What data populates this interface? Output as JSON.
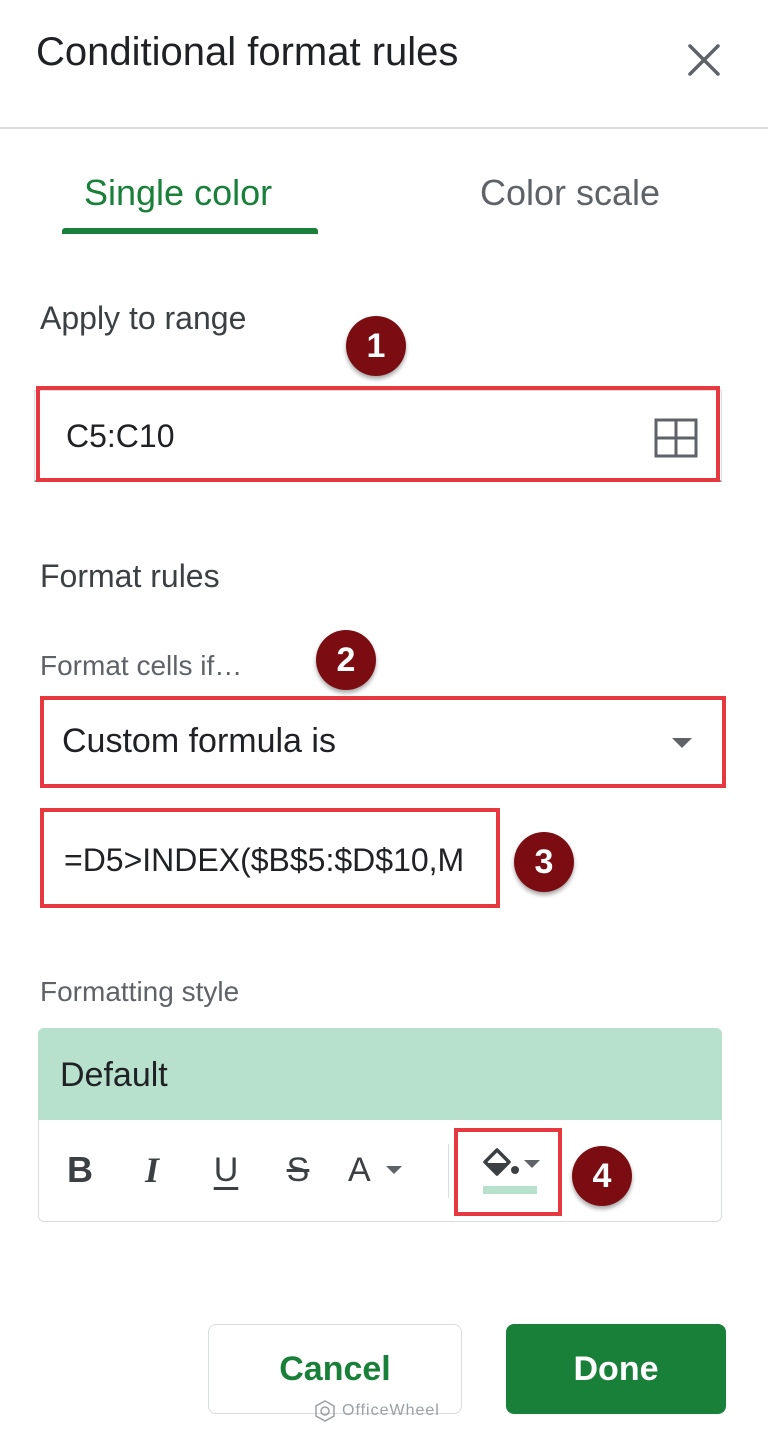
{
  "dialog": {
    "title": "Conditional format rules"
  },
  "tabs": [
    {
      "label": "Single color"
    },
    {
      "label": "Color scale"
    }
  ],
  "apply_range": {
    "label": "Apply to range",
    "value": "C5:C10"
  },
  "format_rules": {
    "heading": "Format rules",
    "condition_label": "Format cells if…",
    "condition_value": "Custom formula is",
    "formula_value": "=D5>INDEX($B$5:$D$10,M"
  },
  "formatting_style": {
    "label": "Formatting style",
    "preview_text": "Default",
    "preview_color": "#b7e1cd",
    "toolbar": {
      "bold": "B",
      "italic": "I",
      "underline": "U",
      "strikethrough": "S",
      "text_color": "A"
    },
    "fill_color_swatch": "#b7e1cd"
  },
  "annotations": [
    "1",
    "2",
    "3",
    "4"
  ],
  "buttons": {
    "cancel": "Cancel",
    "done": "Done"
  },
  "watermark": "OfficeWheel",
  "colors": {
    "accent": "#188038",
    "highlight": "#e5393f",
    "badge": "#7b0d12"
  }
}
